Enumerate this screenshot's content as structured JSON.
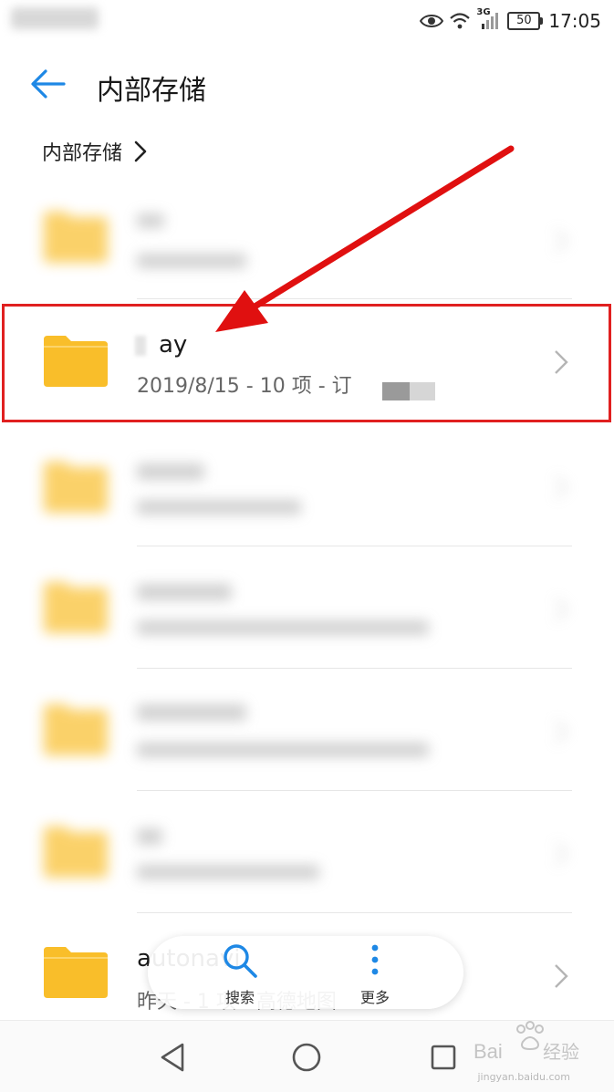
{
  "status_bar": {
    "time": "17:05",
    "battery": "50",
    "network": "3G"
  },
  "header": {
    "title": "内部存储"
  },
  "breadcrumb": {
    "label": "内部存储"
  },
  "rows": [
    {
      "name": "",
      "meta": ""
    },
    {
      "name": "ay",
      "meta": "2019/8/15 - 10 项 - 订"
    },
    {
      "name": "",
      "meta": ""
    },
    {
      "name": "",
      "meta": ""
    },
    {
      "name": "",
      "meta": ""
    },
    {
      "name": "",
      "meta": ""
    },
    {
      "name": "autonavi",
      "meta": "昨天 - 1 项 - 高德地图"
    }
  ],
  "bottom_bar": {
    "search_label": "搜索",
    "more_label": "更多"
  },
  "watermark": {
    "text": "jingyan.baidu.com"
  },
  "colors": {
    "accent": "#1e88e5",
    "folder": "#f9be2a",
    "highlight": "#e02020"
  }
}
